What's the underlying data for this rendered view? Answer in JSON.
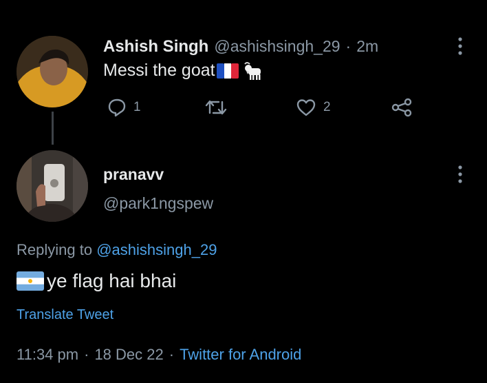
{
  "parent_tweet": {
    "author_name": "Ashish Singh",
    "author_handle": "@ashishsingh_29",
    "separator": "·",
    "time": "2m",
    "text": "Messi the goat",
    "emojis": [
      "🇫🇷",
      "🐐"
    ],
    "reply_count": "1",
    "like_count": "2",
    "icons": [
      "reply-icon",
      "retweet-icon",
      "like-icon",
      "share-icon",
      "more-icon"
    ]
  },
  "reply_tweet": {
    "author_name": "pranavv",
    "author_handle": "@park1ngspew",
    "replying_prefix": "Replying to",
    "replying_handle": "@ashishsingh_29",
    "flag_emoji": "🇦🇷",
    "text": "ye flag hai bhai",
    "translate_label": "Translate Tweet",
    "time": "11:34 pm",
    "date": "18 Dec 22",
    "separator": "·",
    "source": "Twitter for Android"
  },
  "colors": {
    "background": "#000000",
    "primary_text": "#e7e9ea",
    "secondary_text": "#8b98a5",
    "link": "#4ea2e8",
    "thread_line": "#3d4247"
  }
}
